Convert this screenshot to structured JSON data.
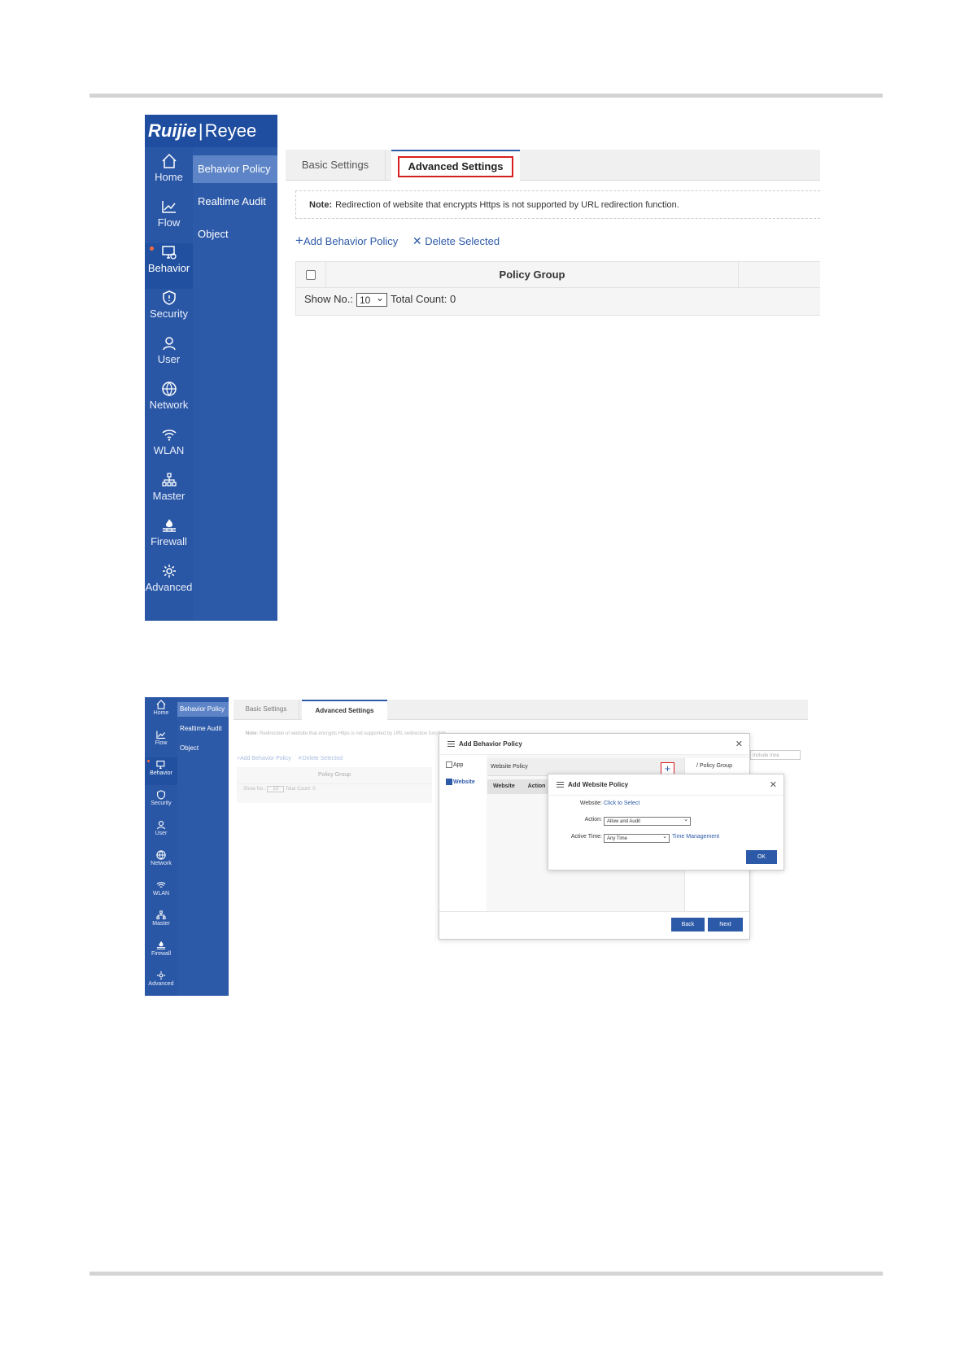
{
  "brand": {
    "logo_main": "Ruijie",
    "logo_sub": "Reyee"
  },
  "rail_items": [
    "Home",
    "Flow",
    "Behavior",
    "Security",
    "User",
    "Network",
    "WLAN",
    "Master",
    "Firewall",
    "Advanced"
  ],
  "submenu": [
    "Behavior Policy",
    "Realtime Audit",
    "Object"
  ],
  "tabs": [
    "Basic Settings",
    "Advanced Settings"
  ],
  "note": {
    "label": "Note:",
    "text": "Redirection of website that encrypts Https is not supported by URL redirection function."
  },
  "actions": {
    "add": "Add Behavior Policy",
    "delete": "Delete Selected"
  },
  "table": {
    "header": "Policy Group",
    "show_no_label": "Show No.:",
    "show_no_value": "10",
    "total": "Total Count: 0"
  },
  "dialog_behavior": {
    "title": "Add Behavior Policy",
    "option_app": "App",
    "option_website": "Website",
    "website_policy_label": "Website Policy",
    "policy_group_label": "Policy Group",
    "col_website": "Website",
    "col_action": "Action",
    "back": "Back",
    "next": "Next",
    "include_placeholder": "Include Inne"
  },
  "dialog_website": {
    "title": "Add Website Policy",
    "website_label": "Website:",
    "website_link": "Click to Select",
    "action_label": "Action:",
    "action_value": "Allow and Audit",
    "time_label": "Active Time:",
    "time_value": "Any Time",
    "time_link": "Time Management",
    "ok": "OK"
  },
  "colors": {
    "nav": "#2d5aa8",
    "accent": "#2d5aa8",
    "highlight": "#d81e1e",
    "badge": "#ff6a3d"
  }
}
